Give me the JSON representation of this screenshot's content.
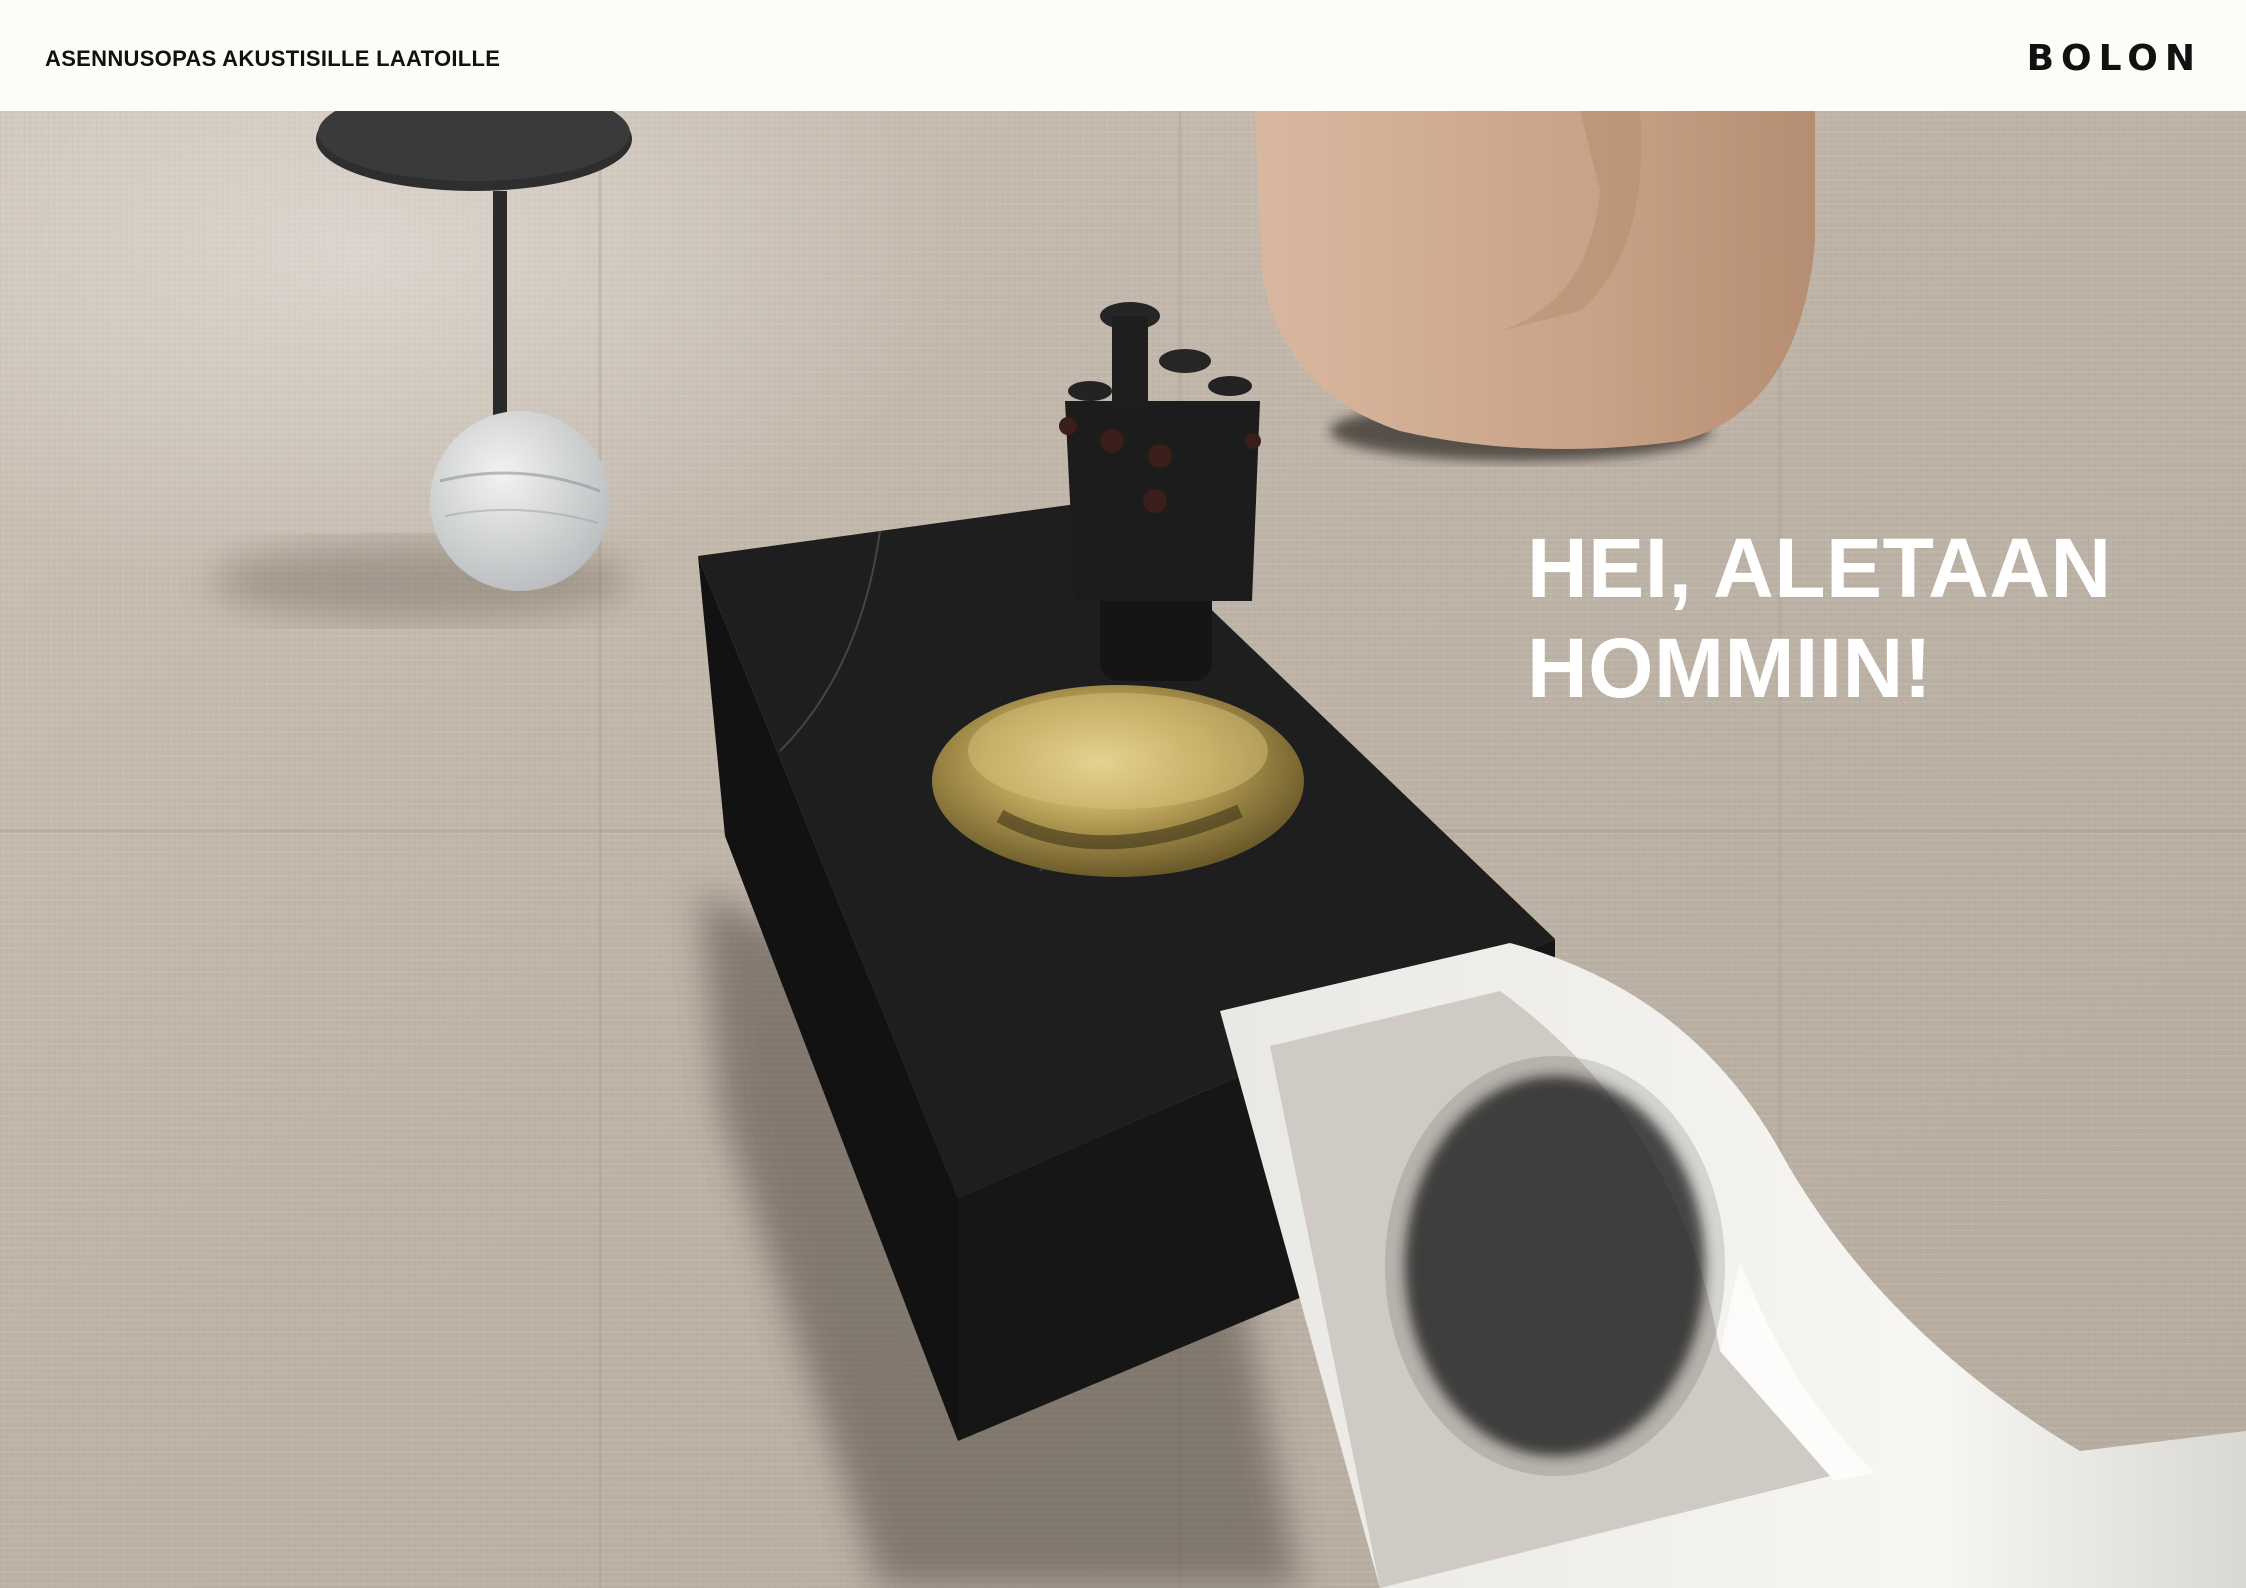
{
  "header": {
    "title": "ASENNUSOPAS AKUSTISILLE LAATOILLE",
    "brand": "BOLON"
  },
  "hero": {
    "headline_line1": "HEI, ALETAAN",
    "headline_line2": "HOMMIIN!"
  }
}
